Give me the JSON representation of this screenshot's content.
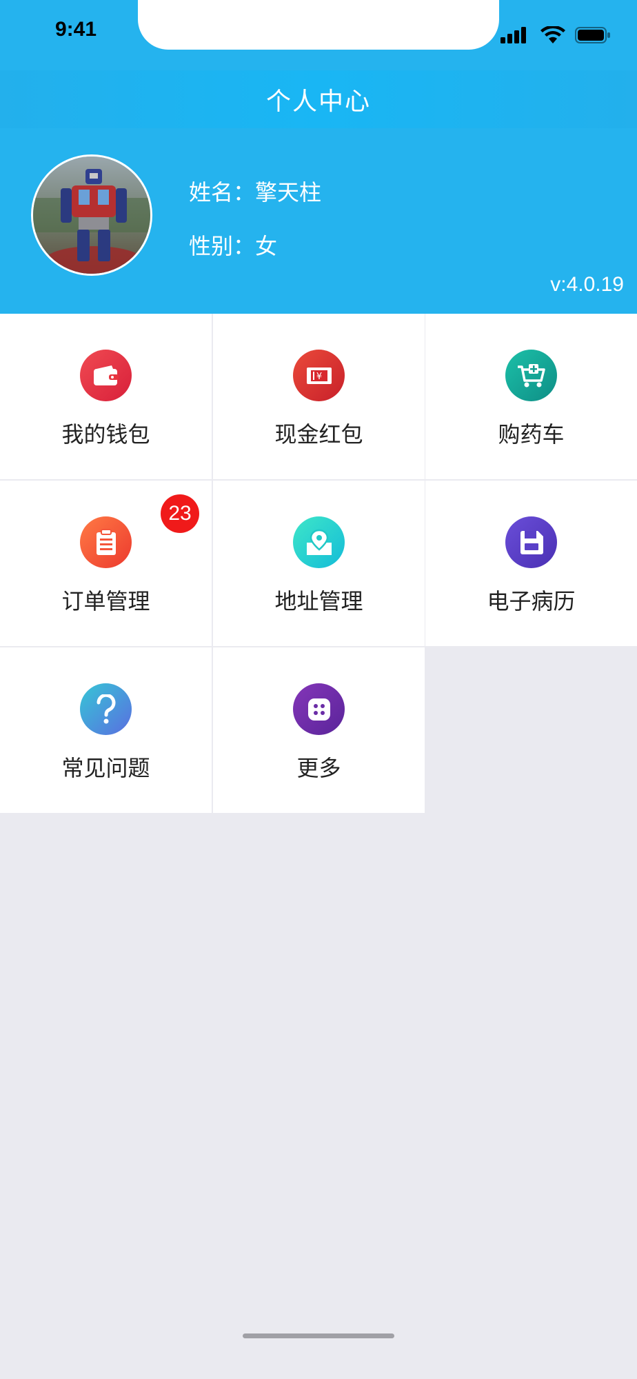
{
  "status": {
    "time": "9:41"
  },
  "nav": {
    "title": "个人中心"
  },
  "profile": {
    "name_label": "姓名：",
    "name_value": "擎天柱",
    "gender_label": "性别：",
    "gender_value": "女",
    "version": "v:4.0.19"
  },
  "menu": {
    "items": [
      {
        "label": "我的钱包",
        "icon": "wallet-icon",
        "color": "#e8343f"
      },
      {
        "label": "现金红包",
        "icon": "red-envelope-icon",
        "color": "#e0302c"
      },
      {
        "label": "购药车",
        "icon": "medicine-cart-icon",
        "color": "#17a89a"
      },
      {
        "label": "订单管理",
        "icon": "order-clipboard-icon",
        "color": "#f4553a",
        "badge": "23"
      },
      {
        "label": "地址管理",
        "icon": "location-pin-icon",
        "color": "#21d2bd"
      },
      {
        "label": "电子病历",
        "icon": "medical-record-icon",
        "color": "#5a40c8"
      },
      {
        "label": "常见问题",
        "icon": "question-icon",
        "color": "#3e8de0"
      },
      {
        "label": "更多",
        "icon": "more-icon",
        "color": "#6a2ca6"
      }
    ]
  }
}
